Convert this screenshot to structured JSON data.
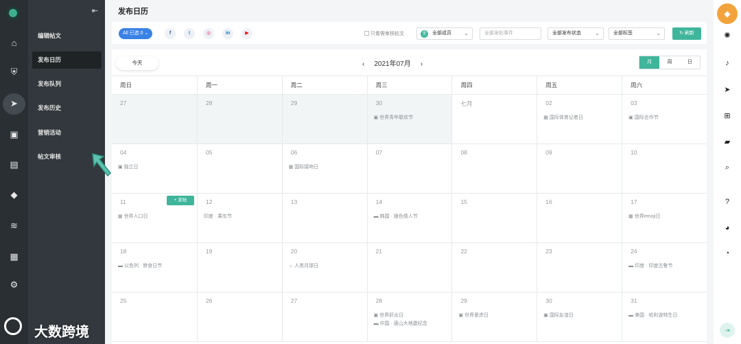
{
  "sidebar_sub": {
    "items": [
      {
        "label": "编辑帖文",
        "active": false
      },
      {
        "label": "发布日历",
        "active": true
      },
      {
        "label": "发布队列",
        "active": false
      },
      {
        "label": "发布历史",
        "active": false
      },
      {
        "label": "营销活动",
        "active": false
      },
      {
        "label": "帖文审核",
        "active": false
      }
    ]
  },
  "page": {
    "title": "发布日历"
  },
  "toolbar": {
    "all_selected": "All 已选 0",
    "social": [
      {
        "name": "facebook-icon",
        "glyph": "f",
        "color": "#3b5998"
      },
      {
        "name": "twitter-icon",
        "glyph": "t",
        "color": "#1da1f2"
      },
      {
        "name": "instagram-icon",
        "glyph": "◎",
        "color": "#e1306c"
      },
      {
        "name": "linkedin-icon",
        "glyph": "in",
        "color": "#0077b5"
      },
      {
        "name": "youtube-icon",
        "glyph": "▶",
        "color": "#ff0000"
      }
    ],
    "only_review": "只看需审核帖文",
    "members": "全部成员",
    "member_avatar": "全",
    "publish_event": "全部发帖事件",
    "publish_status": "全部发布状态",
    "tags": "全部标签",
    "refresh": "刷新"
  },
  "calendar": {
    "today": "今天",
    "month": "2021年07月",
    "views": [
      "月",
      "周",
      "日"
    ],
    "active_view": "月",
    "weekdays": [
      "周日",
      "周一",
      "周二",
      "周三",
      "周四",
      "周五",
      "周六"
    ],
    "post_button": "+ 发帖",
    "weeks": [
      [
        {
          "day": "27",
          "past": true,
          "events": []
        },
        {
          "day": "28",
          "past": true,
          "events": []
        },
        {
          "day": "29",
          "past": true,
          "events": []
        },
        {
          "day": "30",
          "past": true,
          "events": [
            {
              "icon": "gift",
              "text": "世界青年联欢节"
            }
          ]
        },
        {
          "day": "七月",
          "past": false,
          "events": []
        },
        {
          "day": "02",
          "past": false,
          "events": [
            {
              "icon": "calendar",
              "text": "国际体育记者日"
            }
          ]
        },
        {
          "day": "03",
          "past": false,
          "events": [
            {
              "icon": "gift",
              "text": "国际合作节"
            }
          ]
        }
      ],
      [
        {
          "day": "04",
          "past": false,
          "events": [
            {
              "icon": "gift",
              "text": "独立日"
            }
          ]
        },
        {
          "day": "05",
          "past": false,
          "events": []
        },
        {
          "day": "06",
          "past": false,
          "events": [
            {
              "icon": "calendar",
              "text": "国际接吻日"
            }
          ]
        },
        {
          "day": "07",
          "past": false,
          "events": []
        },
        {
          "day": "08",
          "past": false,
          "events": []
        },
        {
          "day": "09",
          "past": false,
          "events": []
        },
        {
          "day": "10",
          "past": false,
          "events": []
        }
      ],
      [
        {
          "day": "11",
          "past": false,
          "events": [
            {
              "icon": "calendar",
              "text": "世界人口日"
            }
          ]
        },
        {
          "day": "12",
          "past": false,
          "events": [
            {
              "icon": "",
              "text": "印度 · 乘车节"
            }
          ]
        },
        {
          "day": "13",
          "past": false,
          "events": []
        },
        {
          "day": "14",
          "past": false,
          "events": [
            {
              "icon": "flag",
              "text": "韩国 · 银色情人节"
            }
          ]
        },
        {
          "day": "15",
          "past": false,
          "events": []
        },
        {
          "day": "16",
          "past": false,
          "events": []
        },
        {
          "day": "17",
          "past": false,
          "events": [
            {
              "icon": "calendar",
              "text": "世界emoji日"
            }
          ]
        }
      ],
      [
        {
          "day": "18",
          "past": false,
          "events": [
            {
              "icon": "flag",
              "text": "以色列 · 禁食日节"
            }
          ]
        },
        {
          "day": "19",
          "past": false,
          "events": []
        },
        {
          "day": "20",
          "past": false,
          "events": [
            {
              "icon": "bulb",
              "text": "人类月球日"
            }
          ]
        },
        {
          "day": "21",
          "past": false,
          "events": []
        },
        {
          "day": "22",
          "past": false,
          "events": []
        },
        {
          "day": "23",
          "past": false,
          "events": []
        },
        {
          "day": "24",
          "past": false,
          "events": [
            {
              "icon": "flag",
              "text": "印度 · 印度古鲁节"
            }
          ]
        }
      ],
      [
        {
          "day": "25",
          "past": false,
          "events": []
        },
        {
          "day": "26",
          "past": false,
          "events": []
        },
        {
          "day": "27",
          "past": false,
          "events": []
        },
        {
          "day": "28",
          "past": false,
          "events": [
            {
              "icon": "gift",
              "text": "世界肝炎日"
            },
            {
              "icon": "flag",
              "text": "中国 · 唐山大地震纪念"
            }
          ]
        },
        {
          "day": "29",
          "past": false,
          "events": [
            {
              "icon": "gift",
              "text": "世界爱虎日"
            }
          ]
        },
        {
          "day": "30",
          "past": false,
          "events": [
            {
              "icon": "gift",
              "text": "国际友谊日"
            }
          ]
        },
        {
          "day": "31",
          "past": false,
          "events": [
            {
              "icon": "flag",
              "text": "美国 · 哈利波特生日"
            }
          ]
        }
      ]
    ]
  },
  "watermark": "大数跨境",
  "colors": {
    "accent": "#3fb59b",
    "brand_blue": "#3b82e6",
    "rail": "#2a2f33",
    "sub_sidebar": "#32383d"
  }
}
